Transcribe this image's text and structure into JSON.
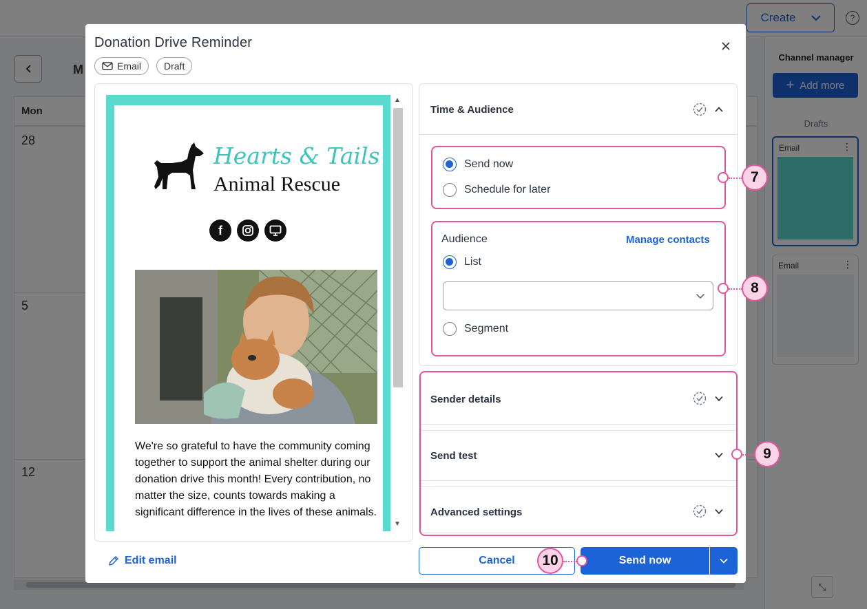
{
  "background": {
    "create_label": "Create",
    "help_glyph": "?",
    "month_fragment": "M",
    "weekday": "Mon",
    "days": [
      "28",
      "5",
      "12"
    ],
    "channel_manager_title": "Channel manager",
    "add_more_label": "Add more",
    "drafts_label": "Drafts",
    "draft_cards": [
      {
        "type": "Email"
      },
      {
        "type": "Email"
      }
    ]
  },
  "modal": {
    "title": "Donation Drive Reminder",
    "chips": {
      "email": "Email",
      "draft": "Draft"
    },
    "preview": {
      "logo_script": "Hearts & Tails",
      "logo_sub": "Animal Rescue",
      "socials": [
        "facebook-icon",
        "instagram-icon",
        "website-icon"
      ],
      "body_text": "We're so grateful to have the community coming together to support the animal shelter during our donation drive this month! Every contribution, no matter the size, counts towards making a significant difference in the lives of these animals."
    },
    "edit_email_label": "Edit email",
    "sections": {
      "time_audience": {
        "title": "Time & Audience",
        "send_now": "Send now",
        "schedule_later": "Schedule for later",
        "audience_label": "Audience",
        "manage_contacts": "Manage contacts",
        "list_label": "List",
        "segment_label": "Segment",
        "list_value": ""
      },
      "sender_details": {
        "title": "Sender details"
      },
      "send_test": {
        "title": "Send test"
      },
      "advanced_settings": {
        "title": "Advanced settings"
      }
    },
    "footer": {
      "cancel_label": "Cancel",
      "send_now_label": "Send now"
    },
    "callouts": [
      "7",
      "8",
      "9",
      "10"
    ]
  },
  "colors": {
    "accent": "#1d63d8",
    "highlight": "#e4559b",
    "email_border": "#5bd9cf"
  }
}
